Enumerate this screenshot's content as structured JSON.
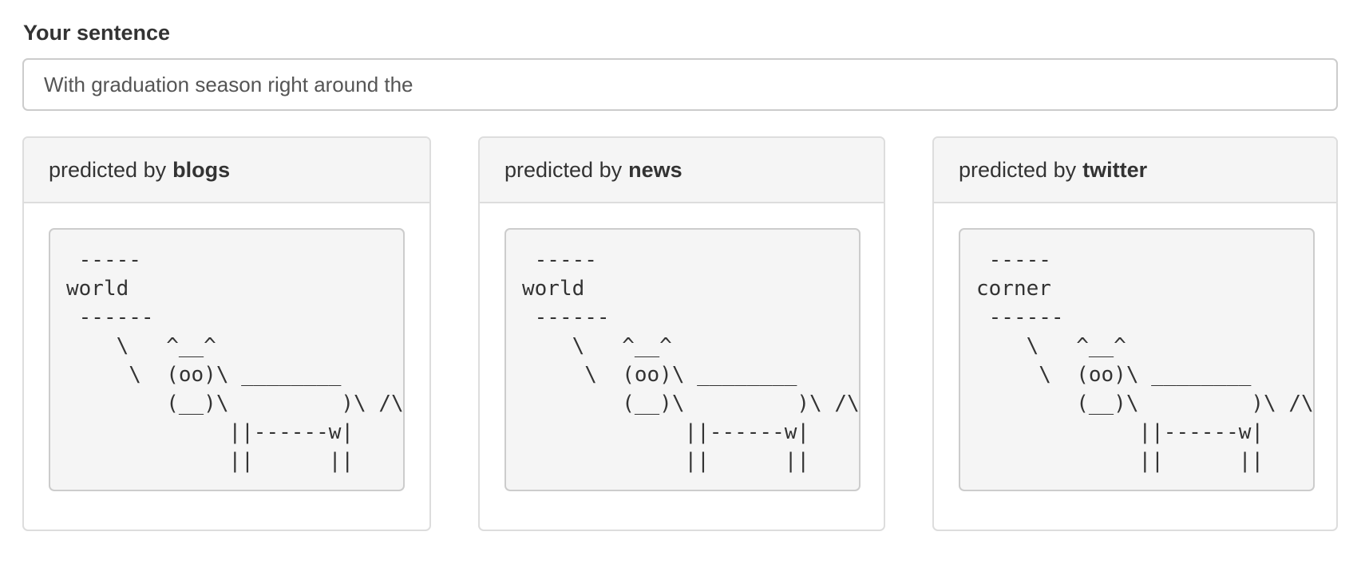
{
  "form": {
    "label": "Your sentence",
    "input_value": "With graduation season right around the"
  },
  "panels": [
    {
      "prefix": "predicted by",
      "source": "blogs",
      "output": " -----\nworld\n ------\n    \\   ^__^\n     \\  (oo)\\ ________\n        (__)\\         )\\ /\\\n             ||------w|\n             ||      ||"
    },
    {
      "prefix": "predicted by",
      "source": "news",
      "output": " -----\nworld\n ------\n    \\   ^__^\n     \\  (oo)\\ ________\n        (__)\\         )\\ /\\\n             ||------w|\n             ||      ||"
    },
    {
      "prefix": "predicted by",
      "source": "twitter",
      "output": " -----\ncorner\n ------\n    \\   ^__^\n     \\  (oo)\\ ________\n        (__)\\         )\\ /\\\n             ||------w|\n             ||      ||"
    }
  ]
}
